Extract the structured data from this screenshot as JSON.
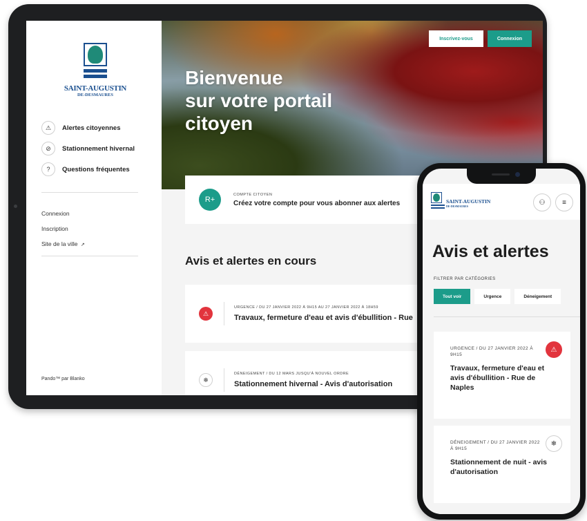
{
  "tablet": {
    "logo": {
      "name": "SAINT-AUGUSTIN",
      "sub": "DE-DESMAURES"
    },
    "nav": [
      {
        "icon": "⚠",
        "label": "Alertes citoyennes"
      },
      {
        "icon": "⊘",
        "label": "Stationnement hivernal"
      },
      {
        "icon": "?",
        "label": "Questions fréquentes"
      }
    ],
    "links": {
      "login": "Connexion",
      "signup": "Inscription",
      "site": "Site de la ville",
      "site_icon": "↗"
    },
    "powered": "Pando™ par Blanko",
    "hero": {
      "title_line1": "Bienvenue",
      "title_line2": "sur votre portail",
      "title_line3": "citoyen",
      "signup_label": "Inscrivez-vous",
      "login_label": "Connexion"
    },
    "account": {
      "eyebrow": "COMPTE CITOYEN",
      "text": "Créez votre compte pour vous abonner aux alertes",
      "icon": "R+"
    },
    "section_title": "Avis et alertes en cours",
    "alerts": [
      {
        "badge": "⚠",
        "meta": "URGENCE  / DU 27 JANVIER 2022 À 9H15 AU 27 JANVIER 2022 À 18H59",
        "title": "Travaux, fermeture d'eau et avis d'ébullition  - Rue"
      },
      {
        "badge": "❄",
        "meta": "DÉNEIGEMENT  / DU 12 MARS JUSQU'À NOUVEL ORDRE",
        "title": "Stationnement hivernal - Avis d'autorisation"
      }
    ]
  },
  "phone": {
    "logo": {
      "name": "SAINT-AUGUSTIN",
      "sub": "DE-DESMAURES"
    },
    "user_icon": "⚇",
    "menu_icon": "≡",
    "title": "Avis et alertes",
    "filter_label": "FILTRER PAR CATÉGORIES",
    "chips": [
      "Tout voir",
      "Urgence",
      "Déneigement"
    ],
    "cards": [
      {
        "badge": "⚠",
        "meta": "URGENCE  / DU 27 JANVIER 2022 À 9H15",
        "title": "Travaux, fermeture d'eau et avis d'ébullition  - Rue de Naples"
      },
      {
        "badge": "❄",
        "meta": "DÉNEIGEMENT  / DU 27 JANVIER 2022 À 9H15",
        "title": "Stationnement de nuit - avis d'autorisation"
      }
    ]
  },
  "colors": {
    "teal": "#1c9c8a",
    "red": "#e2343d",
    "brand_blue": "#1a4f8f"
  }
}
